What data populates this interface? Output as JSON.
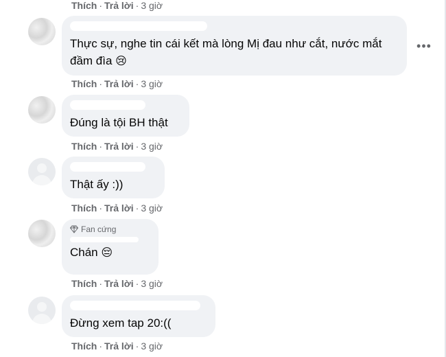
{
  "actions": {
    "like": "Thích",
    "reply": "Trả lời",
    "sep": "·"
  },
  "top_actions": {
    "time": "3 giờ"
  },
  "comments": [
    {
      "text": "Thực sự, nghe tin cái kết mà lòng Mị đau như cắt, nước mắt đầm đìa",
      "emoji": "😢",
      "time": "3 giờ"
    },
    {
      "text": "Đúng là tội BH thật",
      "time": "3 giờ"
    },
    {
      "text": "Thật ấy :))",
      "time": "3 giờ"
    },
    {
      "badge": "Fan cứng",
      "text": "Chán",
      "emoji": "😔",
      "time": "3 giờ"
    },
    {
      "text": "Đừng xem tap 20:((",
      "time": "3 giờ"
    }
  ],
  "more_icon": "ellipsis-icon",
  "colors": {
    "bubble": "#f0f2f5",
    "meta": "#65676b",
    "text": "#050505"
  }
}
